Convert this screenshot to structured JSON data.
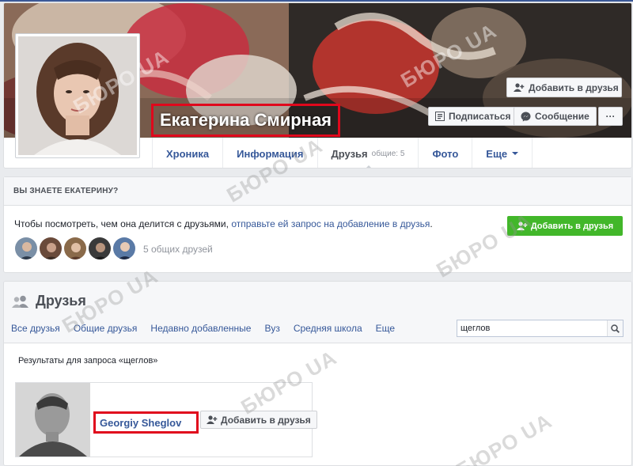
{
  "profile": {
    "name": "Екатерина Смирная",
    "add_friend_cover": "Добавить в друзья",
    "subscribe": "Подписаться",
    "message": "Сообщение",
    "more": "···",
    "tabs": {
      "timeline": "Хроника",
      "info": "Информация",
      "friends": "Друзья",
      "friends_count": "общие: 5",
      "photos": "Фото",
      "more": "Еще"
    }
  },
  "know": {
    "header": "ВЫ ЗНАЕТЕ ЕКАТЕРИНУ?",
    "text_before": "Чтобы посмотреть, чем она делится с друзьями, ",
    "link": "отправьте ей запрос на добавление в друзья",
    "text_after": ".",
    "add_button": "Добавить в друзья",
    "mutual_count": "5 общих друзей"
  },
  "friends": {
    "title": "Друзья",
    "tabs": [
      "Все друзья",
      "Общие друзья",
      "Недавно добавленные",
      "Вуз",
      "Средняя школа",
      "Еще"
    ],
    "search_value": "щеглов",
    "results_label": "Результаты для запроса «щеглов»",
    "result": {
      "name": "Georgiy Sheglov",
      "add_button": "Добавить в друзья"
    }
  },
  "watermark": "БЮРО UA",
  "colors": {
    "facebook_blue": "#3b5998",
    "link_blue": "#365899",
    "green": "#42b72a",
    "highlight_red": "#e0081c"
  }
}
